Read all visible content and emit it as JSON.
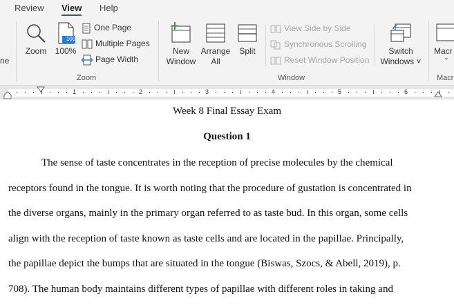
{
  "tabs": [
    {
      "label": "Review"
    },
    {
      "label": "View"
    },
    {
      "label": "Help"
    }
  ],
  "ribbon": {
    "zoom_group": {
      "label": "Zoom",
      "zoom": "Zoom",
      "zoom_100": "100%",
      "zoom_100_badge": "100",
      "one_page": "One Page",
      "multiple_pages": "Multiple Pages",
      "page_width": "Page Width"
    },
    "window_group": {
      "label": "Window",
      "new_window": [
        "New",
        "Window"
      ],
      "arrange_all": [
        "Arrange",
        "All"
      ],
      "split": "Split",
      "view_side_by_side": "View Side by Side",
      "synchronous_scrolling": "Synchronous Scrolling",
      "reset_window_position": "Reset Window Position",
      "switch_windows": [
        "Switch",
        "Windows ˅"
      ]
    },
    "macros_group": {
      "label": "Macr",
      "macros": "Macr"
    },
    "cut_left_label": "ne"
  },
  "ruler": {
    "numbers": [
      "1",
      "2",
      "3",
      "4",
      "5",
      "6"
    ]
  },
  "document": {
    "title": "Week 8 Final Essay Exam",
    "heading": "Question 1",
    "paragraph_lines": [
      "The sense of taste concentrates in the reception of precise molecules by the chemical",
      "receptors found in the tongue. It is worth noting that the procedure of gustation is concentrated in",
      "the diverse organs, mainly in the primary organ referred to as taste bud.  In this organ, some cells",
      "align with the reception of taste known as taste cells and are located in the papillae. Principally,",
      "the papillae depict the bumps that are situated in the tongue (Biswas, Szocs, & Abell, 2019), p.",
      "708). The human body maintains different types of papillae with different roles in taking and"
    ]
  },
  "colors": {
    "ribbon_bg": "#f3f3f3",
    "accent": "#2b579a",
    "disabled_text": "#a6a6a6",
    "new_window_plus": "#3a9a3a",
    "badge_blue": "#2b7cd3"
  }
}
